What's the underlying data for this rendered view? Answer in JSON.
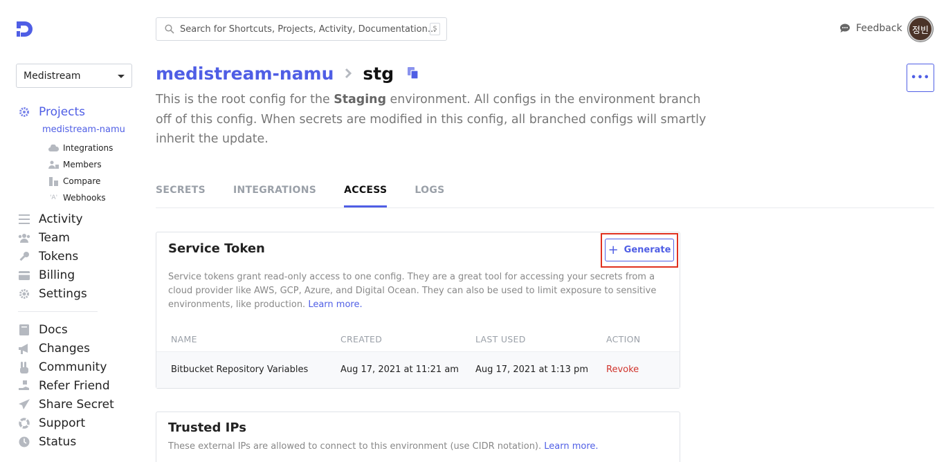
{
  "sidebar": {
    "workspace": "Medistream",
    "primary": [
      {
        "label": "Projects",
        "icon": "gear-icon"
      },
      {
        "label": "Activity",
        "icon": "list-icon"
      },
      {
        "label": "Team",
        "icon": "team-icon"
      },
      {
        "label": "Tokens",
        "icon": "key-icon"
      },
      {
        "label": "Billing",
        "icon": "credit-card-icon"
      },
      {
        "label": "Settings",
        "icon": "cog-icon"
      }
    ],
    "project": "medistream-namu",
    "project_sub": [
      {
        "label": "Integrations",
        "icon": "cloud-icon"
      },
      {
        "label": "Members",
        "icon": "members-icon"
      },
      {
        "label": "Compare",
        "icon": "compare-icon"
      },
      {
        "label": "Webhooks",
        "icon": "webhook-icon"
      }
    ],
    "secondary": [
      {
        "label": "Docs",
        "icon": "book-icon"
      },
      {
        "label": "Changes",
        "icon": "megaphone-icon"
      },
      {
        "label": "Community",
        "icon": "peace-hand-icon"
      },
      {
        "label": "Refer Friend",
        "icon": "gift-hand-icon"
      },
      {
        "label": "Share Secret",
        "icon": "paper-plane-icon"
      },
      {
        "label": "Support",
        "icon": "life-ring-icon"
      },
      {
        "label": "Status",
        "icon": "clock-icon"
      }
    ]
  },
  "topbar": {
    "search_placeholder": "Search for Shortcuts, Projects, Activity, Documentation...",
    "search_shortcut": "S",
    "feedback": "Feedback",
    "avatar_initials": "정빈"
  },
  "header": {
    "project": "medistream-namu",
    "config": "stg",
    "description_pre": "This is the root config for the ",
    "description_env": "Staging",
    "description_post": " environment. All configs in the environment branch off of this config. When secrets are modified in this config, all branched configs will smartly inherit the update."
  },
  "tabs": [
    "SECRETS",
    "INTEGRATIONS",
    "ACCESS",
    "LOGS"
  ],
  "active_tab": "ACCESS",
  "service_token": {
    "title": "Service Token",
    "generate_label": "Generate",
    "description": "Service tokens grant read-only access to one config. They are a great tool for accessing your secrets from a cloud provider like AWS, GCP, Azure, and Digital Ocean. They can also be used to limit exposure to sensitive environments, like production.",
    "learn_more": "Learn more.",
    "columns": [
      "NAME",
      "CREATED",
      "LAST USED",
      "ACTION"
    ],
    "rows": [
      {
        "name": "Bitbucket Repository Variables",
        "created": "Aug 17, 2021 at 11:21 am",
        "last_used": "Aug 17, 2021 at 1:13 pm",
        "action": "Revoke"
      }
    ]
  },
  "trusted_ips": {
    "title": "Trusted IPs",
    "description": "These external IPs are allowed to connect to this environment (use CIDR notation). ",
    "learn_more": "Learn more."
  },
  "colors": {
    "accent": "#4f5ee5",
    "danger": "#d0342c",
    "highlight": "#e0301e"
  }
}
